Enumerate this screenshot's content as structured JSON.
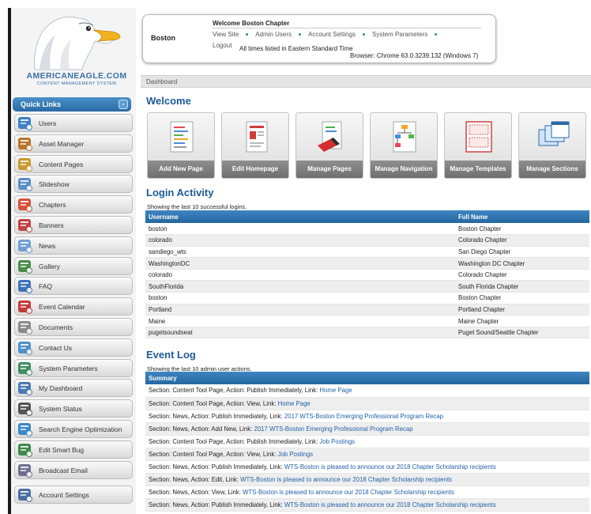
{
  "brand": {
    "name": "AMERICANEAGLE.COM",
    "tagline": "CONTENT MANAGEMENT SYSTEM"
  },
  "quick_links": {
    "title": "Quick Links",
    "toggle": "-",
    "items": [
      {
        "label": "Users",
        "icon": "users-icon"
      },
      {
        "label": "Asset Manager",
        "icon": "asset-manager-icon"
      },
      {
        "label": "Content Pages",
        "icon": "content-pages-icon"
      },
      {
        "label": "Slideshow",
        "icon": "slideshow-icon"
      },
      {
        "label": "Chapters",
        "icon": "chapters-icon"
      },
      {
        "label": "Banners",
        "icon": "banners-icon"
      },
      {
        "label": "News",
        "icon": "news-icon"
      },
      {
        "label": "Gallery",
        "icon": "gallery-icon"
      },
      {
        "label": "FAQ",
        "icon": "faq-icon"
      },
      {
        "label": "Event Calendar",
        "icon": "calendar-icon"
      },
      {
        "label": "Documents",
        "icon": "documents-icon"
      },
      {
        "label": "Contact Us",
        "icon": "contact-us-icon"
      },
      {
        "label": "System Parameters",
        "icon": "globe-icon"
      },
      {
        "label": "My Dashboard",
        "icon": "dashboard-icon"
      },
      {
        "label": "System Status",
        "icon": "system-status-icon"
      },
      {
        "label": "Search Engine Optimization",
        "icon": "seo-icon"
      },
      {
        "label": "Edit Smart Bug",
        "icon": "smart-bug-icon"
      },
      {
        "label": "Broadcast Email",
        "icon": "broadcast-email-icon"
      },
      {
        "label": "Account Settings",
        "icon": "account-settings-icon"
      }
    ]
  },
  "header": {
    "user": "Boston",
    "welcome": "Welcome Boston Chapter",
    "nav": [
      "View Site",
      "Admin Users",
      "Account Settings",
      "System Parameters"
    ],
    "logout": "Logout",
    "timezone": "All times listed in Eastern Standard Time",
    "browser": "Browser: Chrome 63.0.3239.132 (Windows 7)"
  },
  "breadcrumb": "Dashboard",
  "welcome": {
    "title": "Welcome",
    "tiles": [
      {
        "label": "Add New Page",
        "icon": "add-page-icon"
      },
      {
        "label": "Edit Homepage",
        "icon": "edit-homepage-icon"
      },
      {
        "label": "Manage Pages",
        "icon": "manage-pages-icon"
      },
      {
        "label": "Manage Navigation",
        "icon": "manage-navigation-icon"
      },
      {
        "label": "Manage Templates",
        "icon": "manage-templates-icon"
      },
      {
        "label": "Manage Sections",
        "icon": "manage-sections-icon"
      }
    ]
  },
  "login_activity": {
    "title": "Login Activity",
    "caption": "Showing the last 10 successful logins.",
    "columns": [
      "Username",
      "Full Name"
    ],
    "rows": [
      [
        "boston",
        "Boston Chapter"
      ],
      [
        "colorado",
        "Colorado Chapter"
      ],
      [
        "sandiego_wts",
        "San Diego Chapter"
      ],
      [
        "WashingtonDC",
        "Washington DC Chapter"
      ],
      [
        "colorado",
        "Colorado Chapter"
      ],
      [
        "SouthFlorida",
        "South Florida Chapter"
      ],
      [
        "boston",
        "Boston Chapter"
      ],
      [
        "Portland",
        "Portland Chapter"
      ],
      [
        "Maine",
        "Maine Chapter"
      ],
      [
        "pugetsoundseat",
        "Puget Sound/Seattle Chapter"
      ]
    ]
  },
  "event_log": {
    "title": "Event Log",
    "caption": "Showing the last 10 admin user actions.",
    "column": "Summary",
    "rows": [
      {
        "text": "Section: Content Tool Page, Action: Publish Immediately, Link: ",
        "link": "Home Page"
      },
      {
        "text": "Section: Content Tool Page, Action: View, Link: ",
        "link": "Home Page"
      },
      {
        "text": "Section: News, Action: Publish Immediately, Link: ",
        "link": "2017 WTS-Boston Emerging Professional Program Recap"
      },
      {
        "text": "Section: News, Action: Add New, Link: ",
        "link": "2017 WTS-Boston Emerging Professional Program Recap"
      },
      {
        "text": "Section: Content Tool Page, Action: Publish Immediately, Link: ",
        "link": "Job Postings"
      },
      {
        "text": "Section: Content Tool Page, Action: View, Link: ",
        "link": "Job Postings"
      },
      {
        "text": "Section: News, Action: Publish Immediately, Link: ",
        "link": "WTS-Boston is pleased to announce our 2018 Chapter Scholarship recipients"
      },
      {
        "text": "Section: News, Action: Edit, Link: ",
        "link": "WTS-Boston is pleased to announce our 2018 Chapter Scholarship recipients"
      },
      {
        "text": "Section: News, Action: View, Link: ",
        "link": "WTS-Boston is pleased to announce our 2018 Chapter Scholarship recipients"
      },
      {
        "text": "Section: News, Action: Publish Immediately, Link: ",
        "link": "WTS-Boston is pleased to announce our 2018 Chapter Scholarship recipients"
      }
    ]
  },
  "colors": {
    "accent": "#1e5b96",
    "header_bar": "#2f75b3",
    "link": "#2262a8"
  }
}
